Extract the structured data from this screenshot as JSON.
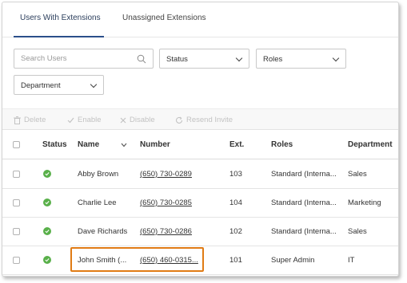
{
  "tabs": [
    {
      "label": "Users With Extensions",
      "active": true
    },
    {
      "label": "Unassigned Extensions",
      "active": false
    }
  ],
  "filters": {
    "search_placeholder": "Search Users",
    "status_label": "Status",
    "roles_label": "Roles",
    "department_label": "Department"
  },
  "toolbar": {
    "delete_label": "Delete",
    "enable_label": "Enable",
    "disable_label": "Disable",
    "resend_label": "Resend Invite"
  },
  "table": {
    "headers": {
      "status": "Status",
      "name": "Name",
      "number": "Number",
      "ext": "Ext.",
      "roles": "Roles",
      "department": "Department"
    },
    "rows": [
      {
        "name": "Abby Brown",
        "number": "(650) 730-0289",
        "ext": "103",
        "roles": "Standard (Interna...",
        "department": "Sales",
        "status": "active"
      },
      {
        "name": "Charlie Lee",
        "number": "(650) 730-0285",
        "ext": "104",
        "roles": "Standard (Interna...",
        "department": "Marketing",
        "status": "active"
      },
      {
        "name": "Dave Richards",
        "number": "(650) 730-0286",
        "ext": "102",
        "roles": "Standard (Interna...",
        "department": "Sales",
        "status": "active"
      },
      {
        "name": "John Smith (...",
        "number": "(650) 460-0315...",
        "ext": "101",
        "roles": "Super Admin",
        "department": "IT",
        "status": "active"
      }
    ]
  },
  "colors": {
    "accent": "#2b4f8a",
    "status_ok": "#59b04a",
    "highlight": "#e07b14"
  }
}
